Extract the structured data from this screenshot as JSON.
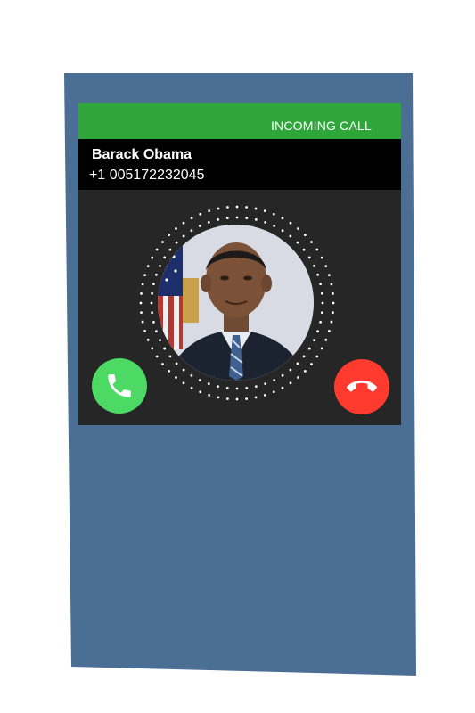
{
  "status_bar": {
    "label": "INCOMING CALL",
    "color": "#2ea63a"
  },
  "caller": {
    "name": "Barack Obama",
    "number": "+1 005172232045",
    "photo": "caller-photo"
  },
  "actions": {
    "accept": {
      "icon": "phone-icon",
      "color": "#4cd964"
    },
    "decline": {
      "icon": "hang-up-icon",
      "color": "#ff3b30"
    }
  },
  "device_color": "#4b6e95"
}
